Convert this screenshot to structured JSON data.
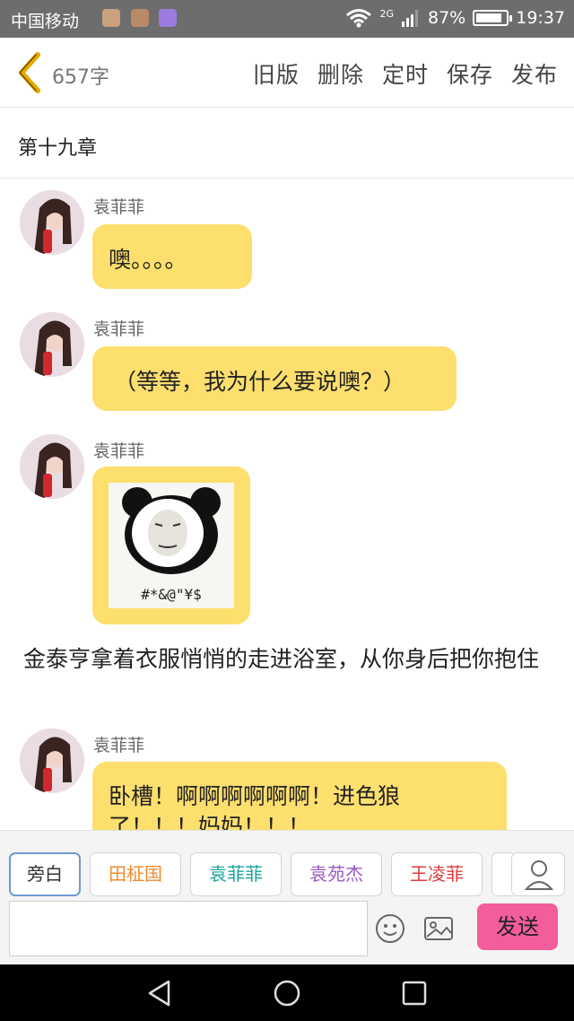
{
  "status_bar": {
    "carrier": "中国移动",
    "network": "2G",
    "battery": "87%",
    "battery_level": 0.87,
    "time": "19:37"
  },
  "toolbar": {
    "word_count": "657字",
    "actions": [
      "旧版",
      "删除",
      "定时",
      "保存",
      "发布"
    ]
  },
  "chapter_title": "第十九章",
  "messages": [
    {
      "speaker": "袁菲菲",
      "text": "噢。。。。"
    },
    {
      "speaker": "袁菲菲",
      "text": "（等等，我为什么要说噢？）"
    },
    {
      "speaker": "袁菲菲",
      "sticker_caption": "#*&@\"¥$"
    },
    {
      "speaker": "袁菲菲",
      "line1": "卧槽！啊啊啊啊啊啊！进色狼",
      "line2": "了！！！妈妈！！！"
    }
  ],
  "narration": "金泰亨拿着衣服悄悄的走进浴室，从你身后把你抱住",
  "characters": [
    {
      "name": "旁白",
      "color": "#333333"
    },
    {
      "name": "田柾国",
      "color": "#f08a2c"
    },
    {
      "name": "袁菲菲",
      "color": "#1aa59a"
    },
    {
      "name": "袁苑杰",
      "color": "#9b59c5"
    },
    {
      "name": "王凌菲",
      "color": "#e03c3c"
    }
  ],
  "input": {
    "value": "",
    "placeholder": ""
  },
  "send_label": "发送",
  "colors": {
    "bubble": "#fddf6e",
    "send": "#f45d9c",
    "selected_chip_border": "#6f9ad0"
  },
  "icons": [
    "back-chevron-icon",
    "emoji-icon",
    "image-icon",
    "person-icon",
    "nav-back-icon",
    "nav-home-icon",
    "nav-recents-icon"
  ]
}
